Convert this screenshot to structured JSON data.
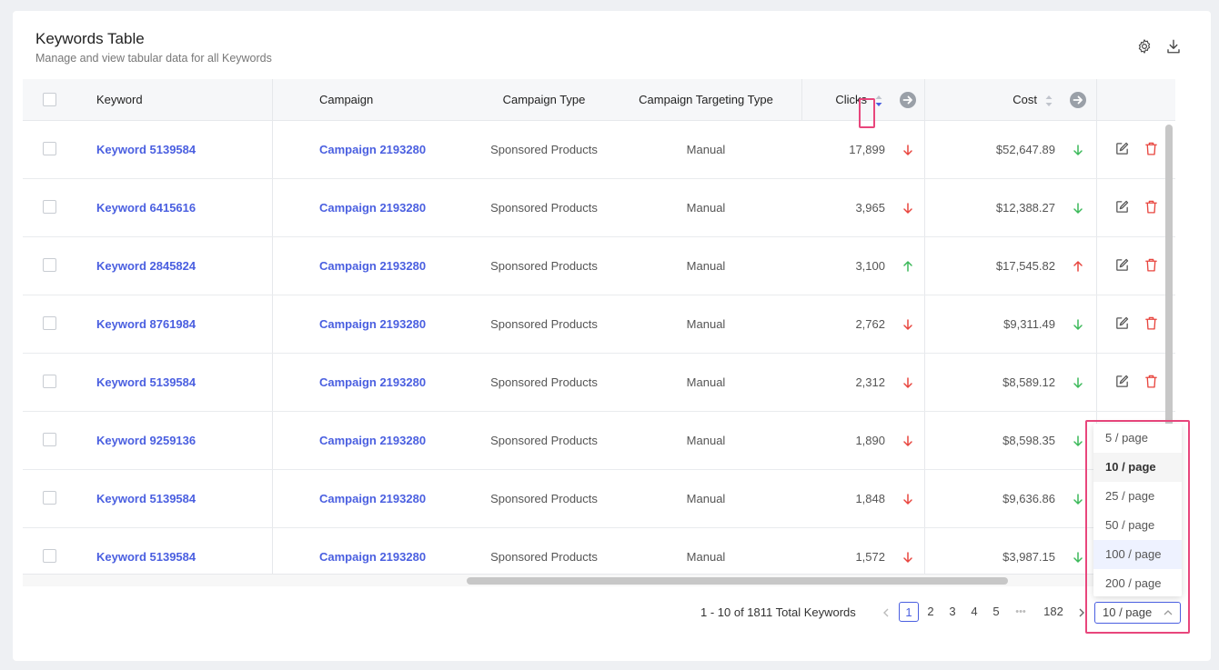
{
  "header": {
    "title": "Keywords Table",
    "subtitle": "Manage and view tabular data for all Keywords",
    "settings_icon": "gear-icon",
    "download_icon": "download-icon"
  },
  "columns": {
    "keyword": "Keyword",
    "campaign": "Campaign",
    "campaign_type": "Campaign Type",
    "targeting_type": "Campaign Targeting Type",
    "clicks": "Clicks",
    "cost": "Cost"
  },
  "rows": [
    {
      "keyword": "Keyword 5139584",
      "campaign": "Campaign 2193280",
      "type": "Sponsored Products",
      "targeting": "Manual",
      "clicks": "17,899",
      "clicks_trend": "down",
      "cost": "$52,647.89",
      "cost_trend": "down"
    },
    {
      "keyword": "Keyword 6415616",
      "campaign": "Campaign 2193280",
      "type": "Sponsored Products",
      "targeting": "Manual",
      "clicks": "3,965",
      "clicks_trend": "down",
      "cost": "$12,388.27",
      "cost_trend": "down"
    },
    {
      "keyword": "Keyword 2845824",
      "campaign": "Campaign 2193280",
      "type": "Sponsored Products",
      "targeting": "Manual",
      "clicks": "3,100",
      "clicks_trend": "up",
      "cost": "$17,545.82",
      "cost_trend": "up"
    },
    {
      "keyword": "Keyword 8761984",
      "campaign": "Campaign 2193280",
      "type": "Sponsored Products",
      "targeting": "Manual",
      "clicks": "2,762",
      "clicks_trend": "down",
      "cost": "$9,311.49",
      "cost_trend": "down"
    },
    {
      "keyword": "Keyword 5139584",
      "campaign": "Campaign 2193280",
      "type": "Sponsored Products",
      "targeting": "Manual",
      "clicks": "2,312",
      "clicks_trend": "down",
      "cost": "$8,589.12",
      "cost_trend": "down"
    },
    {
      "keyword": "Keyword 9259136",
      "campaign": "Campaign 2193280",
      "type": "Sponsored Products",
      "targeting": "Manual",
      "clicks": "1,890",
      "clicks_trend": "down",
      "cost": "$8,598.35",
      "cost_trend": "down"
    },
    {
      "keyword": "Keyword 5139584",
      "campaign": "Campaign 2193280",
      "type": "Sponsored Products",
      "targeting": "Manual",
      "clicks": "1,848",
      "clicks_trend": "down",
      "cost": "$9,636.86",
      "cost_trend": "down"
    },
    {
      "keyword": "Keyword 5139584",
      "campaign": "Campaign 2193280",
      "type": "Sponsored Products",
      "targeting": "Manual",
      "clicks": "1,572",
      "clicks_trend": "down",
      "cost": "$3,987.15",
      "cost_trend": "down"
    }
  ],
  "pagination": {
    "summary": "1 - 10 of 1811 Total Keywords",
    "pages": [
      "1",
      "2",
      "3",
      "4",
      "5"
    ],
    "ellipsis": "•••",
    "last_page": "182",
    "current": "1",
    "page_size": "10 / page",
    "page_size_options": [
      "5 / page",
      "10 / page",
      "25 / page",
      "50 / page",
      "100 / page",
      "200 / page"
    ],
    "selected_option": "10 / page",
    "hovered_option": "100 / page"
  },
  "colors": {
    "link": "#4a5fe0",
    "down": "#e8463f",
    "up": "#3cb95a",
    "highlight": "#e8467c",
    "delete": "#e8463f"
  }
}
